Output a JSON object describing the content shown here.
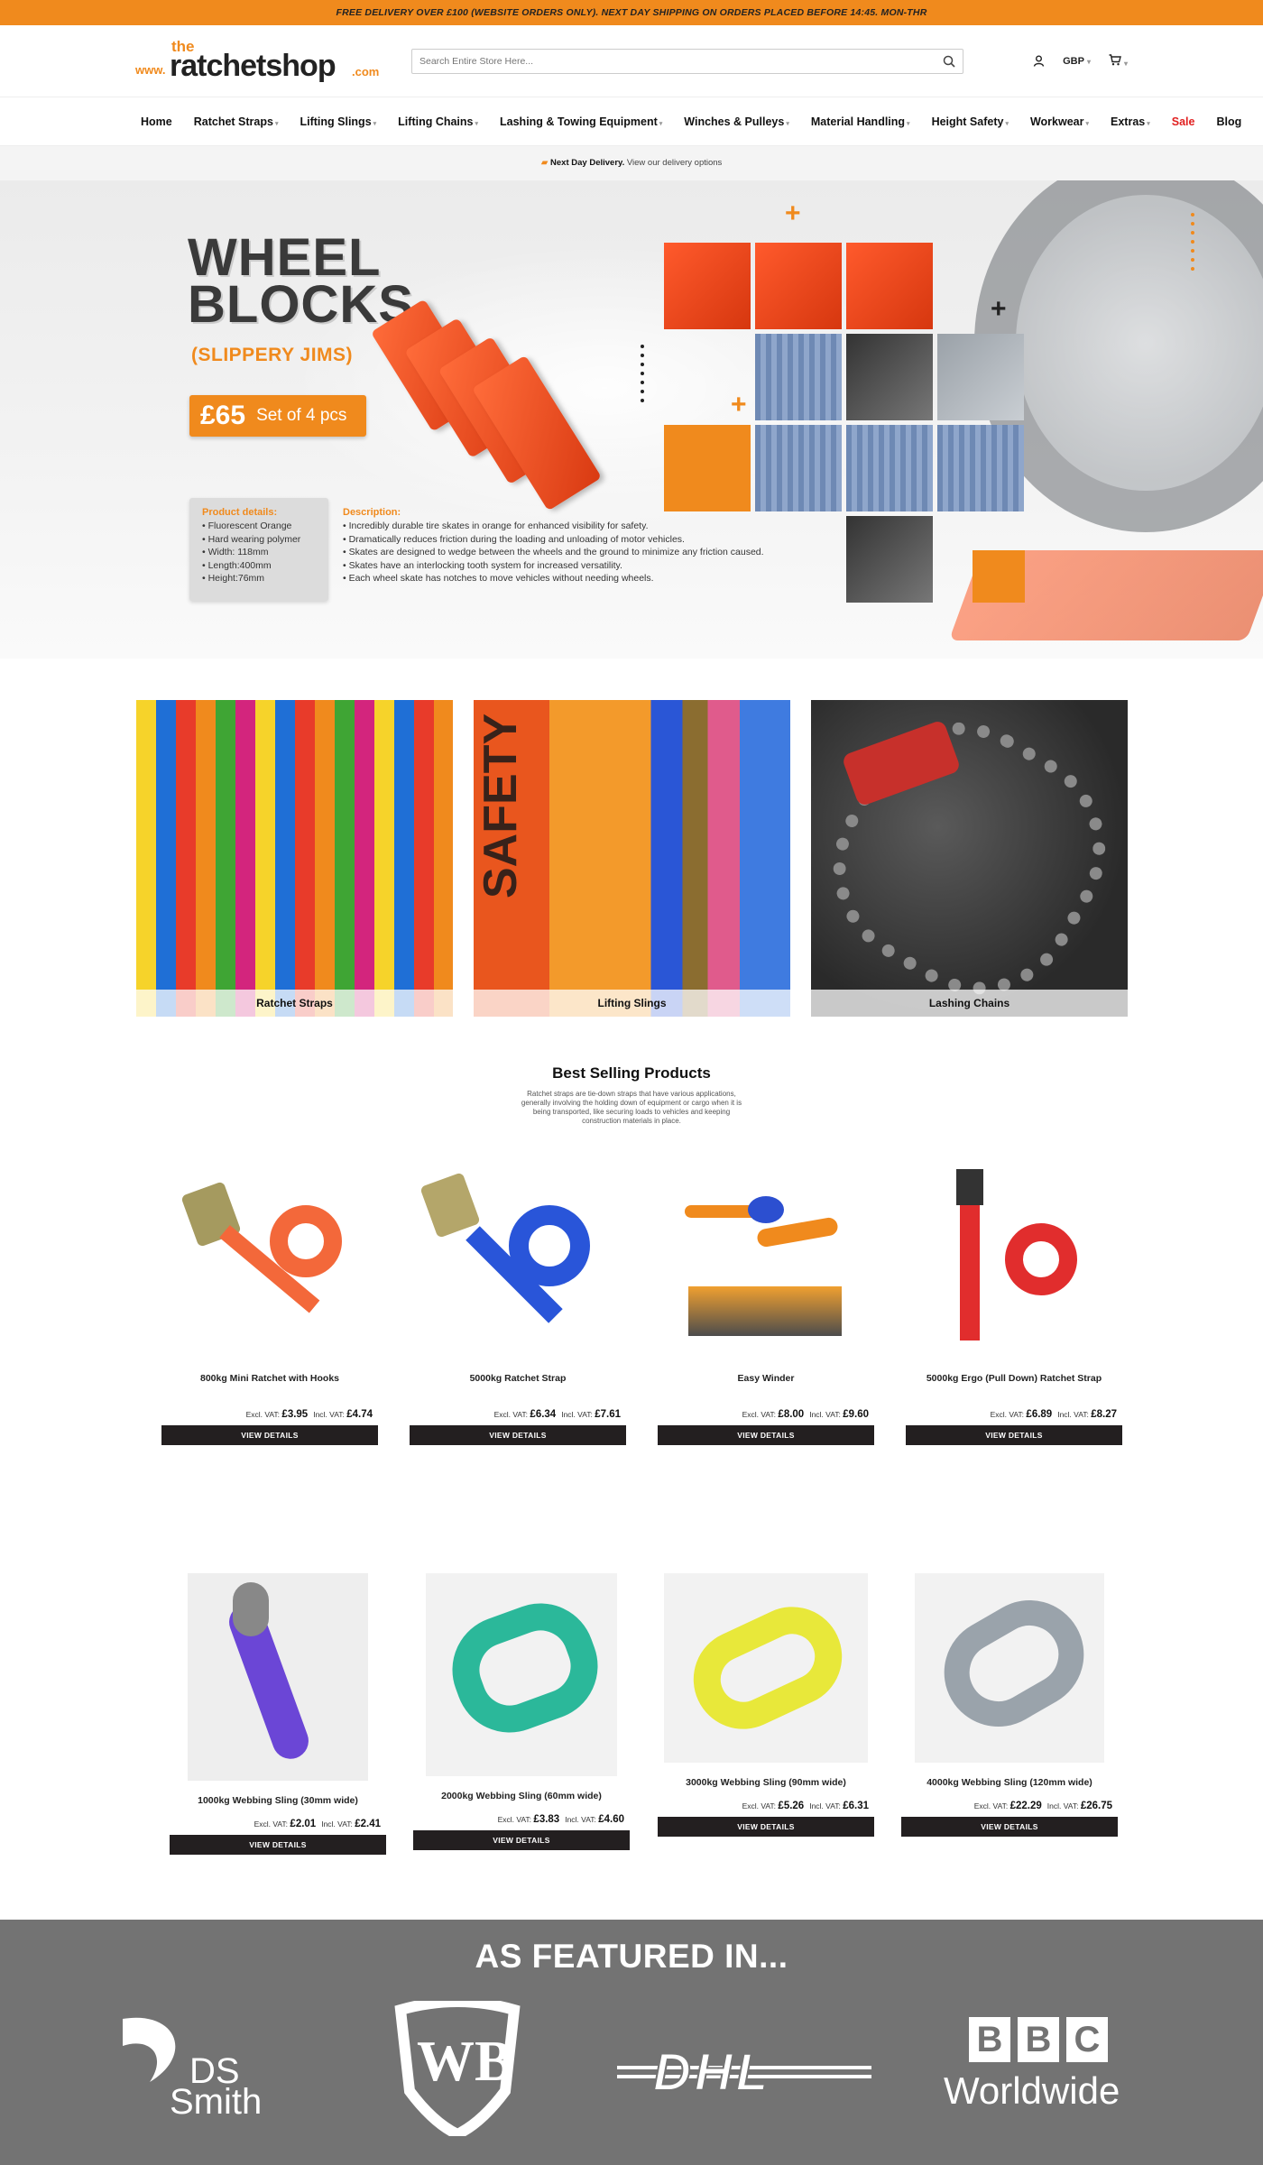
{
  "topbar": {
    "text": "FREE DELIVERY OVER £100 (WEBSITE ORDERS ONLY). NEXT DAY SHIPPING ON ORDERS PLACED BEFORE 14:45. MON-THR"
  },
  "header": {
    "logo": {
      "the": "the",
      "www": "www.",
      "brand": "ratchetshop",
      "com": ".com"
    },
    "search_placeholder": "Search Entire Store Here...",
    "currency": "GBP"
  },
  "nav": {
    "items": [
      "Home",
      "Ratchet Straps",
      "Lifting Slings",
      "Lifting Chains",
      "Lashing & Towing Equipment",
      "Winches & Pulleys",
      "Material Handling",
      "Height Safety",
      "Workwear",
      "Extras",
      "Sale",
      "Blog"
    ]
  },
  "delivery": {
    "bold": "Next Day Delivery.",
    "text": " View our delivery options"
  },
  "hero": {
    "title_line1": "WHEEL",
    "title_line2": "BLOCKS",
    "subtitle": "(SLIPPERY JIMS)",
    "price": "£65",
    "price_note": "Set of 4 pcs",
    "details_heading": "Product details:",
    "details": [
      "Fluorescent Orange",
      "Hard wearing polymer",
      "Width: 118mm",
      "Length:400mm",
      "Height:76mm"
    ],
    "description_heading": "Description:",
    "description": [
      "Incredibly durable tire skates in orange for enhanced visibility for safety.",
      "Dramatically reduces friction during the loading and unloading of motor vehicles.",
      "Skates are designed to wedge between the wheels and the ground to minimize any friction caused.",
      "Skates have an interlocking tooth system for increased versatility.",
      "Each wheel skate has notches to move vehicles without needing wheels."
    ]
  },
  "categories": [
    {
      "label": "Ratchet Straps"
    },
    {
      "label": "Lifting Slings"
    },
    {
      "label": "Lashing Chains"
    }
  ],
  "best_selling": {
    "title": "Best Selling Products",
    "description": "Ratchet straps are tie-down straps that have various applications, generally involving the holding down of equipment or cargo when it is being transported, like securing loads to vehicles and keeping construction materials in place."
  },
  "labels": {
    "excl": "Excl. VAT:",
    "incl": "Incl. VAT:",
    "button": "VIEW DETAILS"
  },
  "products_row1": [
    {
      "name": "800kg Mini Ratchet with Hooks",
      "excl": "£3.95",
      "incl": "£4.74"
    },
    {
      "name": "5000kg Ratchet Strap",
      "excl": "£6.34",
      "incl": "£7.61"
    },
    {
      "name": "Easy Winder",
      "excl": "£8.00",
      "incl": "£9.60"
    },
    {
      "name": "5000kg Ergo (Pull Down) Ratchet Strap",
      "excl": "£6.89",
      "incl": "£8.27"
    }
  ],
  "products_row2": [
    {
      "name": "1000kg Webbing Sling (30mm wide)",
      "excl": "£2.01",
      "incl": "£2.41"
    },
    {
      "name": "2000kg Webbing Sling (60mm wide)",
      "excl": "£3.83",
      "incl": "£4.60"
    },
    {
      "name": "3000kg Webbing Sling (90mm wide)",
      "excl": "£5.26",
      "incl": "£6.31"
    },
    {
      "name": "4000kg Webbing Sling (120mm wide)",
      "excl": "£22.29",
      "incl": "£26.75"
    }
  ],
  "featured": {
    "title": "AS FEATURED IN...",
    "logos": {
      "ds1": "DS",
      "ds2": "Smith",
      "wb": "WB",
      "dhl": "DHL",
      "bbc_b1": "B",
      "bbc_b2": "B",
      "bbc_c": "C",
      "bbc_world": "Worldwide"
    }
  },
  "colors": {
    "accent": "#f08a1d",
    "dark": "#231f20",
    "sale": "#e12020",
    "featured_bg": "#737373"
  },
  "icons": {
    "search": "search-icon",
    "account": "user-icon",
    "cart": "cart-icon"
  }
}
